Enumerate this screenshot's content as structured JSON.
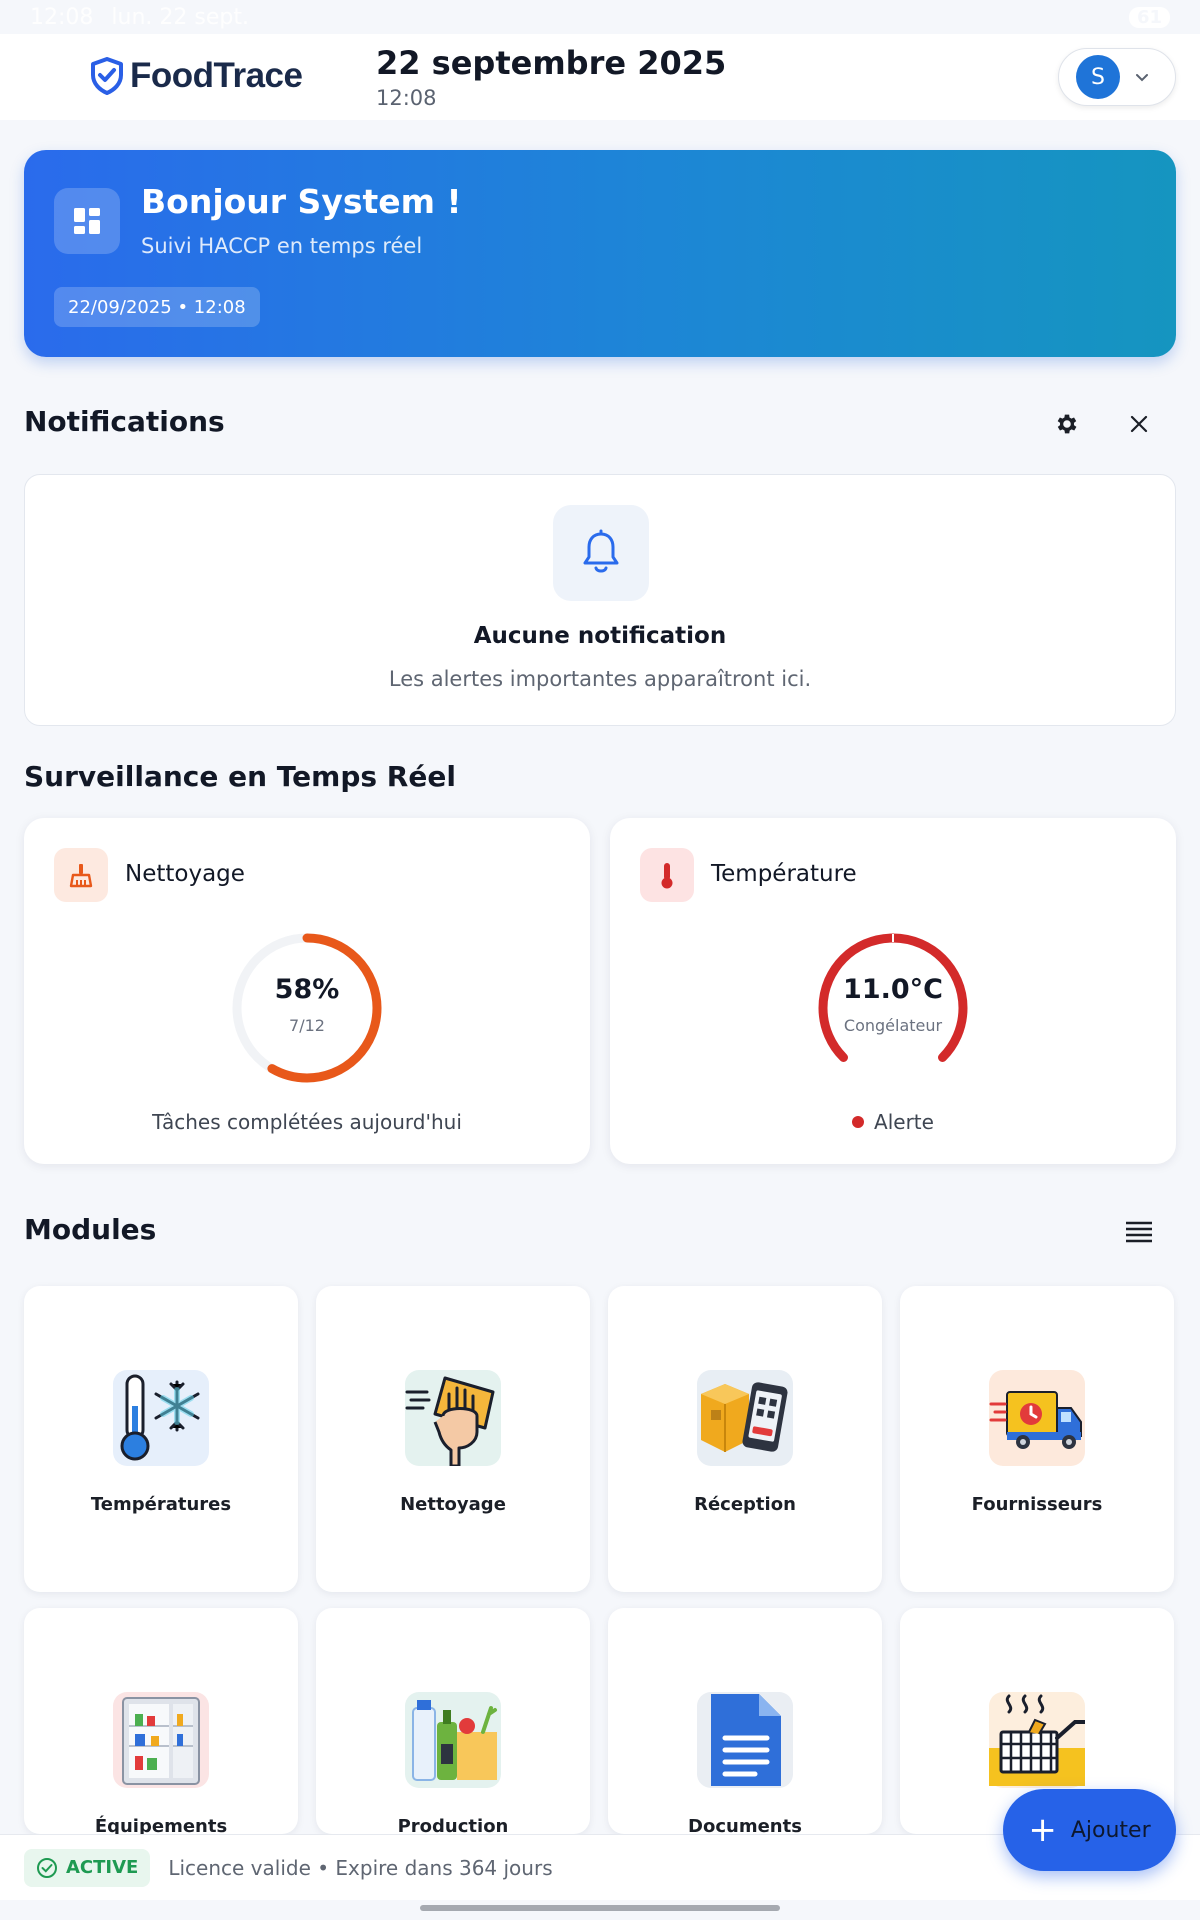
{
  "status_bar": {
    "time": "12:08",
    "date": "lun. 22 sept.",
    "battery": "61"
  },
  "header": {
    "brand": "FoodTrace",
    "date": "22 septembre 2025",
    "time": "12:08",
    "user_initial": "S"
  },
  "hero": {
    "title": "Bonjour System !",
    "subtitle": "Suivi HACCP en temps réel",
    "chip": "22/09/2025 • 12:08"
  },
  "notifications": {
    "title": "Notifications",
    "empty_title": "Aucune notification",
    "empty_subtitle": "Les alertes importantes apparaîtront ici."
  },
  "monitoring": {
    "title": "Surveillance en Temps Réel",
    "cleaning": {
      "title": "Nettoyage",
      "percent_label": "58%",
      "count_label": "7/12",
      "done": 7,
      "total": 12,
      "footer": "Tâches complétées aujourd'hui",
      "color": "#e8581a"
    },
    "temperature": {
      "title": "Température",
      "value_label": "11.0°C",
      "location": "Congélateur",
      "status": "Alerte",
      "level": 1.0,
      "color": "#d32a2a"
    }
  },
  "modules": {
    "title": "Modules",
    "items": [
      {
        "label": "Températures",
        "icon": "thermometer-snowflake-icon"
      },
      {
        "label": "Nettoyage",
        "icon": "cleaning-hand-icon"
      },
      {
        "label": "Réception",
        "icon": "reception-box-phone-icon"
      },
      {
        "label": "Fournisseurs",
        "icon": "delivery-truck-icon"
      },
      {
        "label": "Équipements",
        "icon": "fridge-icon"
      },
      {
        "label": "Production",
        "icon": "groceries-icon"
      },
      {
        "label": "Documents",
        "icon": "document-icon"
      },
      {
        "label": "",
        "icon": "fryer-icon"
      }
    ]
  },
  "fab": {
    "label": "Ajouter"
  },
  "licence": {
    "status": "ACTIVE",
    "text": "Licence valide • Expire dans 364 jours"
  }
}
